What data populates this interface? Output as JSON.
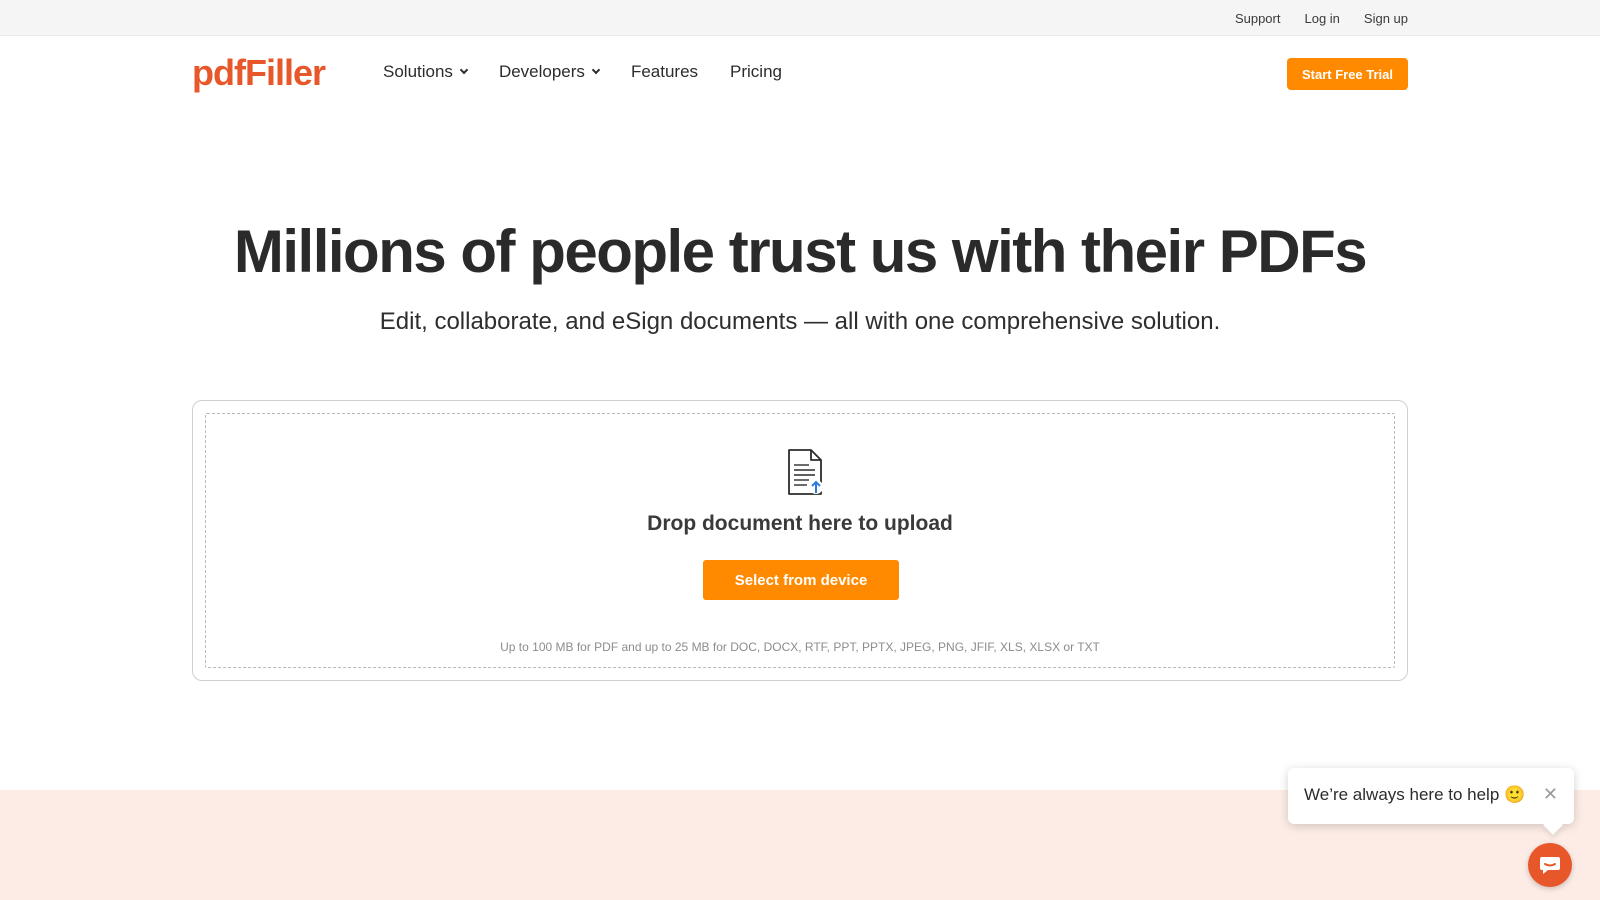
{
  "topbar": {
    "links": [
      "Support",
      "Log in",
      "Sign up"
    ]
  },
  "nav": {
    "logo": "pdfFiller",
    "menu": [
      {
        "label": "Solutions",
        "has_dropdown": true
      },
      {
        "label": "Developers",
        "has_dropdown": true
      },
      {
        "label": "Features",
        "has_dropdown": false
      },
      {
        "label": "Pricing",
        "has_dropdown": false
      }
    ],
    "cta_label": "Start Free Trial"
  },
  "hero": {
    "title": "Millions of people trust us with their PDFs",
    "subtitle": "Edit, collaborate, and eSign documents — all with one comprehensive solution."
  },
  "upload": {
    "icon": "document-upload-icon",
    "drop_text": "Drop document here to upload",
    "button_label": "Select from device",
    "limits_text": "Up to 100 MB for PDF and up to 25 MB for DOC, DOCX, RTF, PPT, PPTX, JPEG, PNG, JFIF, XLS, XLSX or TXT"
  },
  "chat": {
    "message": "We’re always here to help 🙂",
    "close_glyph": "✕",
    "launcher_icon": "chat-icon"
  },
  "colors": {
    "brand": "#e8572a",
    "accent_button": "#ff8a00",
    "peach_section": "#fdece6"
  }
}
